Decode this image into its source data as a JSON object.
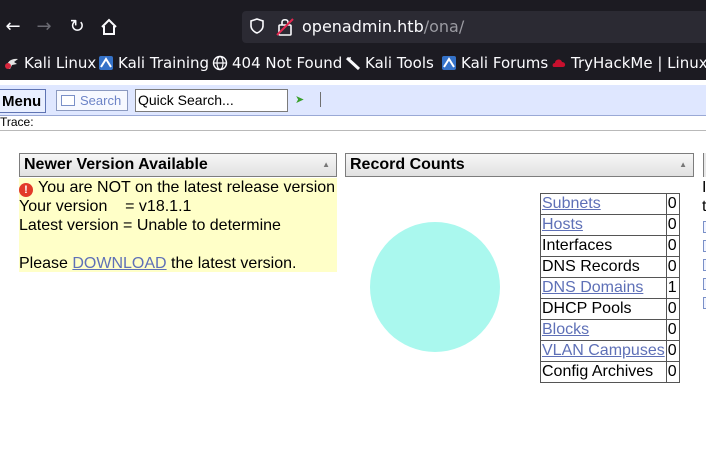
{
  "browser": {
    "url_host": "openadmin.htb",
    "url_path": "/ona/",
    "bookmarks": [
      {
        "label": "Kali Linux",
        "icon": "kali-dragon-icon"
      },
      {
        "label": "Kali Training",
        "icon": "kali-training-icon"
      },
      {
        "label": "404 Not Found",
        "icon": "globe-icon"
      },
      {
        "label": "Kali Tools",
        "icon": "kali-tools-icon"
      },
      {
        "label": "Kali Forums",
        "icon": "kali-forums-icon"
      },
      {
        "label": "TryHackMe | Linux A",
        "icon": "tryhackme-icon"
      }
    ]
  },
  "toolbar": {
    "menu_label": "Menu",
    "search_label": "Search",
    "quick_search_value": "Quick Search...",
    "trace_label": "Trace:"
  },
  "version_panel": {
    "title": "Newer Version Available",
    "warning": "You are NOT on the latest release version",
    "your_version": "Your version    = v18.1.1",
    "latest_version": "Latest version = Unable to determine",
    "please": "Please ",
    "download": "DOWNLOAD",
    "after": " the latest version."
  },
  "record_panel": {
    "title": "Record Counts",
    "pie_color": "#aaf8ee",
    "rows": [
      {
        "label": "Subnets",
        "count": "0",
        "link": true
      },
      {
        "label": "Hosts",
        "count": "0",
        "link": true
      },
      {
        "label": "Interfaces",
        "count": "0",
        "link": false
      },
      {
        "label": "DNS Records",
        "count": "0",
        "link": false
      },
      {
        "label": "DNS Domains",
        "count": "1",
        "link": true
      },
      {
        "label": "DHCP Pools",
        "count": "0",
        "link": false
      },
      {
        "label": "Blocks",
        "count": "0",
        "link": true
      },
      {
        "label": "VLAN Campuses",
        "count": "0",
        "link": true
      },
      {
        "label": "Config Archives",
        "count": "0",
        "link": false
      }
    ]
  },
  "third_panel_fragments": [
    "I",
    "t"
  ]
}
